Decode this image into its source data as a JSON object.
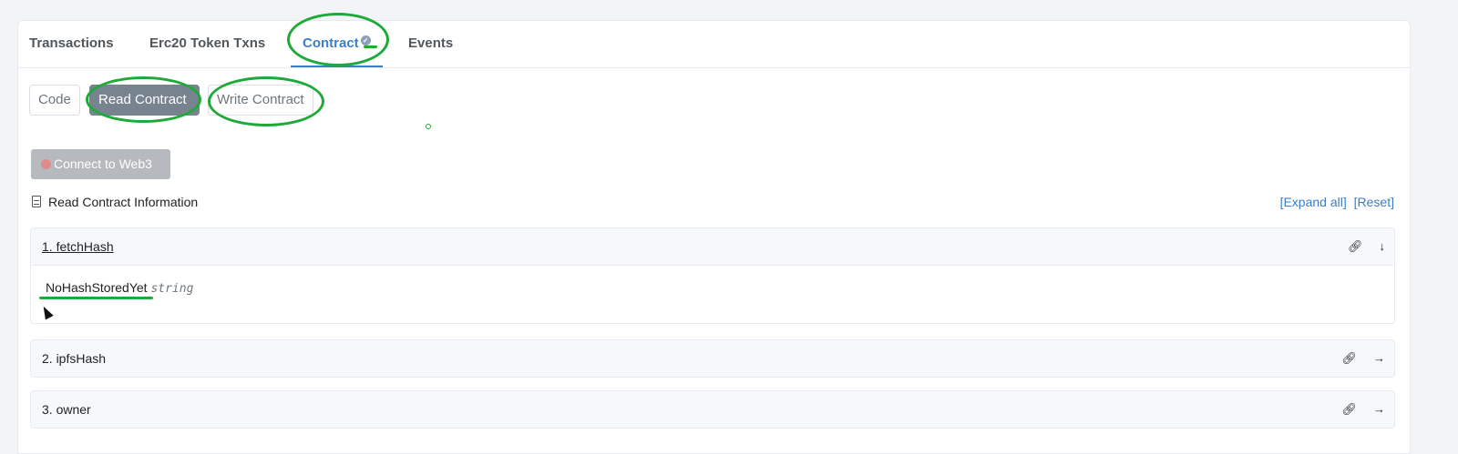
{
  "tabs": [
    {
      "label": "Transactions"
    },
    {
      "label": "Erc20 Token Txns"
    },
    {
      "label": "Contract",
      "active": true
    },
    {
      "label": "Events"
    }
  ],
  "subtabs": [
    {
      "label": "Code"
    },
    {
      "label": "Read Contract",
      "active": true
    },
    {
      "label": "Write Contract"
    }
  ],
  "connect_button": "Connect to Web3",
  "section_title": "Read Contract Information",
  "links": {
    "expand": "[Expand all]",
    "reset": "[Reset]"
  },
  "functions": [
    {
      "name": "1. fetchHash",
      "expanded": true,
      "result_value": "NoHashStoredYet",
      "result_type": "string"
    },
    {
      "name": "2. ipfsHash",
      "expanded": false
    },
    {
      "name": "3. owner",
      "expanded": false
    }
  ],
  "icons": {
    "link": "link-icon",
    "expanded": "arrow-down-icon",
    "collapsed": "arrow-right-icon",
    "verified": "check-circle-icon",
    "doc": "document-icon"
  },
  "colors": {
    "accent": "#3c7fc7",
    "annotation": "#1eaa38",
    "active_subtab": "#77838f"
  }
}
